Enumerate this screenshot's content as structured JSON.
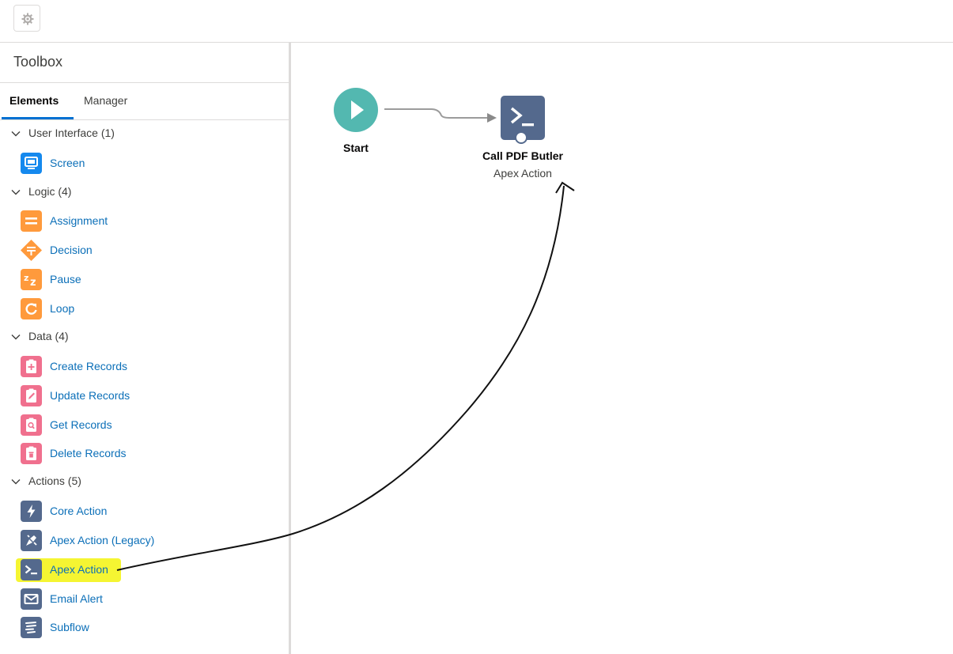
{
  "header": {
    "settings_icon": "gear-icon"
  },
  "toolbox": {
    "title": "Toolbox",
    "tabs": [
      {
        "label": "Elements",
        "active": true
      },
      {
        "label": "Manager",
        "active": false
      }
    ],
    "sections": [
      {
        "label": "User Interface (1)",
        "items": [
          {
            "label": "Screen",
            "icon": "screen-icon",
            "color": "#1589ee"
          }
        ]
      },
      {
        "label": "Logic (4)",
        "items": [
          {
            "label": "Assignment",
            "icon": "assignment-icon",
            "color": "#ff9a3c"
          },
          {
            "label": "Decision",
            "icon": "decision-icon",
            "color": "#ff9a3c"
          },
          {
            "label": "Pause",
            "icon": "pause-icon",
            "color": "#ff9a3c"
          },
          {
            "label": "Loop",
            "icon": "loop-icon",
            "color": "#ff9a3c"
          }
        ]
      },
      {
        "label": "Data (4)",
        "items": [
          {
            "label": "Create Records",
            "icon": "create-records-icon",
            "color": "#f0708e"
          },
          {
            "label": "Update Records",
            "icon": "update-records-icon",
            "color": "#f0708e"
          },
          {
            "label": "Get Records",
            "icon": "get-records-icon",
            "color": "#f0708e"
          },
          {
            "label": "Delete Records",
            "icon": "delete-records-icon",
            "color": "#f0708e"
          }
        ]
      },
      {
        "label": "Actions (5)",
        "items": [
          {
            "label": "Core Action",
            "icon": "lightning-icon",
            "color": "#54698d"
          },
          {
            "label": "Apex Action (Legacy)",
            "icon": "apex-legacy-icon",
            "color": "#54698d"
          },
          {
            "label": "Apex Action",
            "icon": "apex-terminal-icon",
            "color": "#54698d",
            "highlighted": true
          },
          {
            "label": "Email Alert",
            "icon": "email-icon",
            "color": "#54698d"
          },
          {
            "label": "Subflow",
            "icon": "subflow-icon",
            "color": "#54698d"
          }
        ]
      }
    ]
  },
  "canvas": {
    "start": {
      "label": "Start",
      "icon": "play-icon",
      "color": "#53b8b0"
    },
    "action": {
      "title": "Call PDF Butler",
      "subtitle": "Apex Action",
      "icon": "apex-terminal-icon",
      "color": "#54698d"
    }
  },
  "colors": {
    "link": "#0b6fb8",
    "highlight": "#f5f532",
    "tab_accent": "#0070d2"
  }
}
